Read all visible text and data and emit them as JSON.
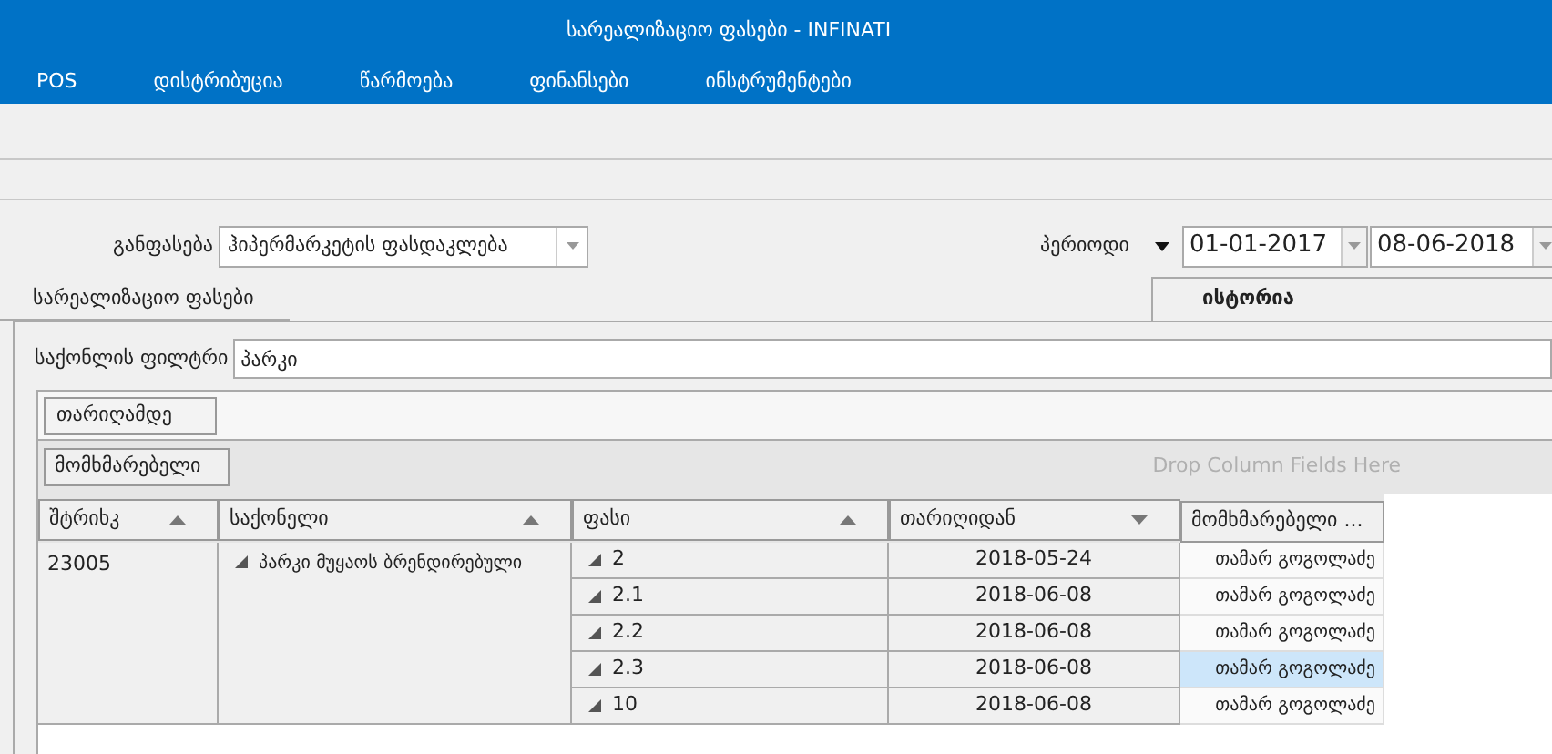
{
  "window": {
    "title": "სარეალიზაციო ფასები - INFINATI"
  },
  "menu": [
    "POS",
    "დისტრიბუცია",
    "წარმოება",
    "ფინანსები",
    "ინსტრუმენტები"
  ],
  "pricing": {
    "label": "განფასება",
    "value": "ჰიპერმარკეტის ფასდაკლება"
  },
  "period": {
    "label": "პერიოდი",
    "from": "01-01-2017",
    "to": "08-06-2018"
  },
  "tabs": [
    {
      "label": "სარეალიზაციო ფასები",
      "selected": false
    },
    {
      "label": "ისტორია",
      "selected": true
    }
  ],
  "filter": {
    "label": "საქონლის ფილტრი",
    "value": "პარკი"
  },
  "pivot": {
    "filter_fields": [
      "თარიღამდე"
    ],
    "row_fields": [
      "მომხმარებელი"
    ],
    "column_drop_hint": "Drop Column Fields Here",
    "columns": [
      {
        "label": "შტრიხკ",
        "sorted": true,
        "descending": false
      },
      {
        "label": "საქონელი",
        "sorted": true,
        "descending": false
      },
      {
        "label": "ფასი",
        "sorted": true,
        "descending": false
      },
      {
        "label": "თარიღიდან",
        "sorted": true,
        "descending": true
      },
      {
        "label": "მომხმარებელი ...",
        "sorted": false
      }
    ],
    "groups": [
      {
        "barcode": "23005",
        "product": "პარკი მუყაოს ბრენდირებული",
        "expanded": true,
        "rows": [
          {
            "price": "2",
            "expanded": true,
            "date": "2018-05-24",
            "user": "თამარ გოგოლაძე",
            "selected": false
          },
          {
            "price": "2.1",
            "expanded": true,
            "date": "2018-06-08",
            "user": "თამარ გოგოლაძე",
            "selected": false
          },
          {
            "price": "2.2",
            "expanded": true,
            "date": "2018-06-08",
            "user": "თამარ გოგოლაძე",
            "selected": false
          },
          {
            "price": "2.3",
            "expanded": true,
            "date": "2018-06-08",
            "user": "თამარ გოგოლაძე",
            "selected": true
          },
          {
            "price": "10",
            "expanded": true,
            "date": "2018-06-08",
            "user": "თამარ გოგოლაძე",
            "selected": false
          }
        ]
      }
    ]
  }
}
